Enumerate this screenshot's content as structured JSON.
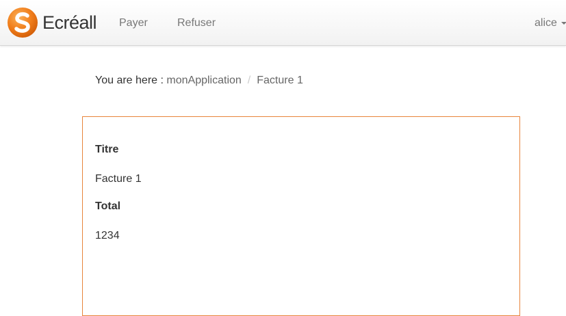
{
  "navbar": {
    "brand_name": "Ecréall",
    "logo_icon": "ecreall-s-logo-icon",
    "logo_color": "#f07d1a",
    "links": [
      {
        "label": "Payer"
      },
      {
        "label": "Refuser"
      }
    ],
    "user": {
      "name": "alice",
      "icon": "caret-down-icon"
    }
  },
  "breadcrumb": {
    "prefix": "You are here :",
    "items": [
      {
        "label": "monApplication"
      },
      {
        "label": "Facture 1"
      }
    ],
    "divider": "/"
  },
  "invoice": {
    "border_color": "#e8843a",
    "fields": [
      {
        "label": "Titre",
        "value": "Facture 1"
      },
      {
        "label": "Total",
        "value": "1234"
      }
    ]
  }
}
